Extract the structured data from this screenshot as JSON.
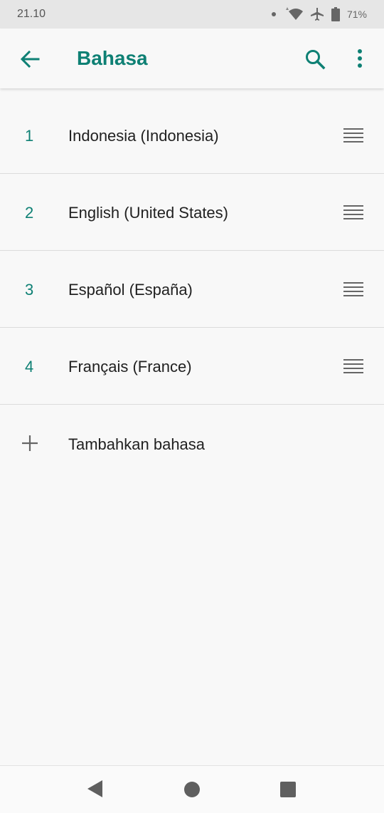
{
  "status_bar": {
    "time": "21.10",
    "battery": "71%",
    "icons": [
      "dot-icon",
      "wifi-icon",
      "airplane-icon",
      "battery-icon"
    ]
  },
  "app_bar": {
    "title": "Bahasa",
    "icons": [
      "back-arrow-icon",
      "search-icon",
      "more-vert-icon"
    ]
  },
  "languages": [
    {
      "index": "1",
      "label": "Indonesia (Indonesia)"
    },
    {
      "index": "2",
      "label": "English (United States)"
    },
    {
      "index": "3",
      "label": "Español (España)"
    },
    {
      "index": "4",
      "label": "Français (France)"
    }
  ],
  "add_language": {
    "label": "Tambahkan bahasa",
    "icon": "plus-icon"
  },
  "nav_bar": {
    "icons": [
      "nav-back-icon",
      "nav-home-icon",
      "nav-recents-icon"
    ]
  },
  "colors": {
    "accent": "#0e8074",
    "text": "#212121",
    "background": "#f8f8f8"
  }
}
